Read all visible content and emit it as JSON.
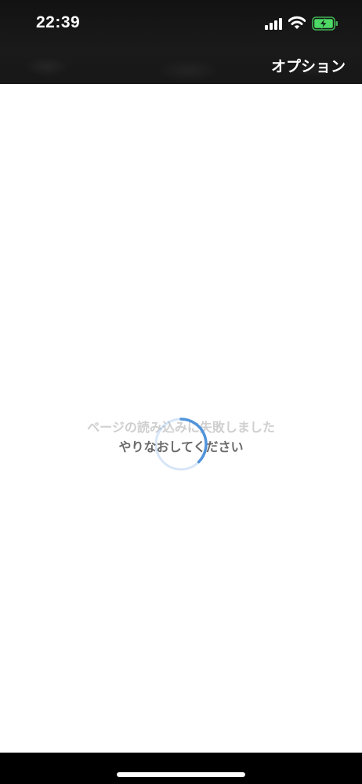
{
  "status_bar": {
    "time": "22:39",
    "icons": [
      "cellular-signal-icon",
      "wifi-icon",
      "battery-charging-icon"
    ],
    "battery_color": "#4cd964"
  },
  "header": {
    "options_label": "オプション"
  },
  "content": {
    "error_message": "ページの読み込みに失敗しました",
    "retry_label": "やりなおしてください",
    "spinner_color": "#4a8fd9"
  }
}
